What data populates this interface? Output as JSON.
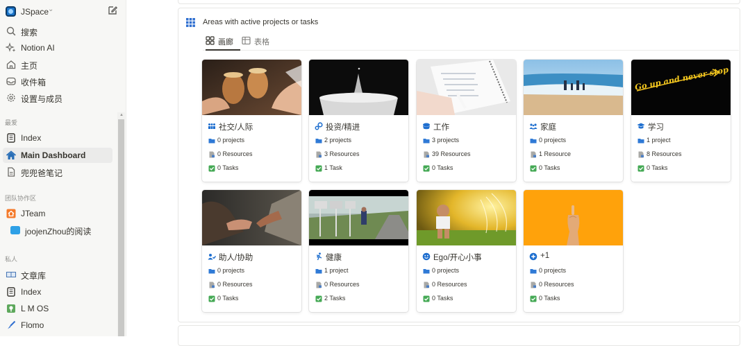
{
  "workspace": {
    "name": "JSpace"
  },
  "sidebar": {
    "top_items": [
      {
        "label": "搜索",
        "icon": "search-icon"
      },
      {
        "label": "Notion AI",
        "icon": "sparkle-icon"
      },
      {
        "label": "主页",
        "icon": "home-icon"
      },
      {
        "label": "收件箱",
        "icon": "inbox-icon"
      },
      {
        "label": "设置与成员",
        "icon": "gear-icon"
      }
    ],
    "favorites_title": "最爱",
    "favorites": [
      {
        "label": "Index",
        "icon": "notebook-icon"
      },
      {
        "label": "Main Dashboard",
        "icon": "house-icon",
        "active": true
      },
      {
        "label": "兜兜爸笔记",
        "icon": "page-icon"
      }
    ],
    "team_title": "团队协作区",
    "team": [
      {
        "label": "JTeam",
        "icon": "team-house-icon"
      },
      {
        "label": "joojenZhou的阅读",
        "icon": "blue-square-icon"
      }
    ],
    "private_title": "私人",
    "private": [
      {
        "label": "文章库",
        "icon": "book-icon"
      },
      {
        "label": "Index",
        "icon": "notebook-icon"
      },
      {
        "label": "L M OS",
        "icon": "map-pin-icon"
      },
      {
        "label": "Flomo",
        "icon": "brush-icon"
      }
    ]
  },
  "panel": {
    "title": "Areas with active projects or tasks",
    "tabs": [
      {
        "label": "画廊",
        "icon": "gallery-icon"
      },
      {
        "label": "表格",
        "icon": "table-icon"
      }
    ]
  },
  "cards": [
    {
      "title": "社交/人际",
      "icon": "people-icon",
      "projects": "0 projects",
      "resources": "0 Resources",
      "tasks": "0 Tasks",
      "cover": "drinks"
    },
    {
      "title": "投资/精进",
      "icon": "gears-icon",
      "projects": "2 projects",
      "resources": "3 Resources",
      "tasks": "1 Task",
      "cover": "water-drop"
    },
    {
      "title": "工作",
      "icon": "briefcase-icon",
      "projects": "3 projects",
      "resources": "39 Resources",
      "tasks": "0 Tasks",
      "cover": "notebook"
    },
    {
      "title": "家庭",
      "icon": "family-icon",
      "projects": "0 projects",
      "resources": "1 Resource",
      "tasks": "0 Tasks",
      "cover": "beach"
    },
    {
      "title": "学习",
      "icon": "graduation-icon",
      "projects": "1 project",
      "resources": "8 Resources",
      "tasks": "0 Tasks",
      "cover": "neon",
      "cover_text": "Go up and never stop"
    },
    {
      "title": "助人/协助",
      "icon": "person-check-icon",
      "projects": "0 projects",
      "resources": "0 Resources",
      "tasks": "0 Tasks",
      "cover": "hands"
    },
    {
      "title": "健康",
      "icon": "runner-icon",
      "projects": "1 project",
      "resources": "0 Resources",
      "tasks": "2 Tasks",
      "cover": "road"
    },
    {
      "title": "Ego/开心小事",
      "icon": "smile-icon",
      "projects": "0 projects",
      "resources": "0 Resources",
      "tasks": "0 Tasks",
      "cover": "sprinkler"
    },
    {
      "title": "+1",
      "icon": "plus-circle-icon",
      "projects": "0 projects",
      "resources": "0 Resources",
      "tasks": "0 Tasks",
      "cover": "orange"
    }
  ],
  "colors": {
    "accent_blue": "#1f6fcf",
    "check_green": "#45a955",
    "folder_blue": "#2f7ad6",
    "cover_orange": "#ffa20b"
  }
}
